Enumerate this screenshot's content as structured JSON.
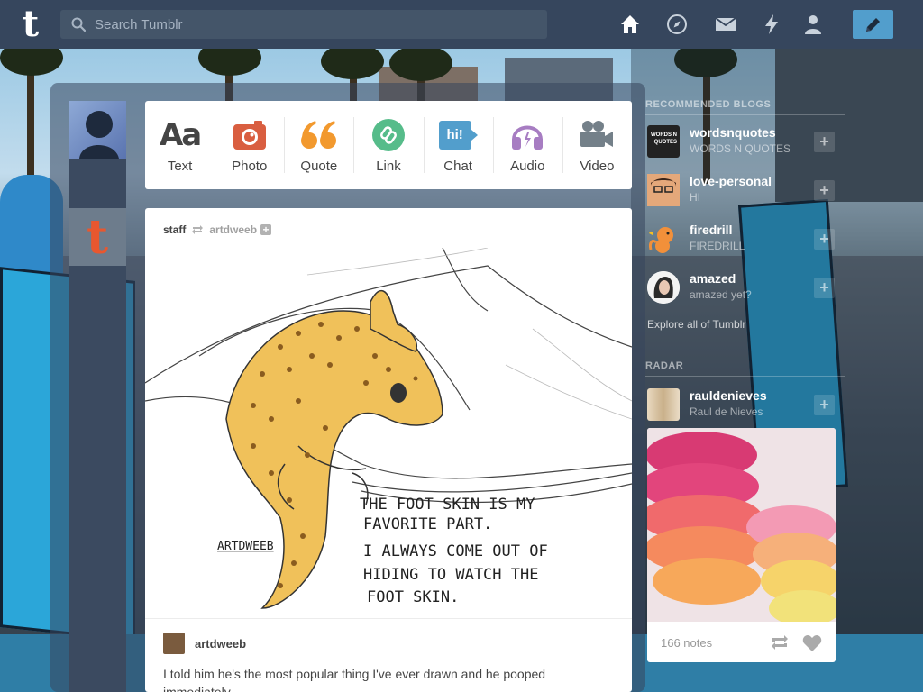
{
  "header": {
    "search_placeholder": "Search Tumblr",
    "logo_letter": "t"
  },
  "post_types": [
    {
      "label": "Text",
      "glyph": "Aa",
      "color": "#444444"
    },
    {
      "label": "Photo",
      "icon": "camera-icon",
      "color": "#d95e40"
    },
    {
      "label": "Quote",
      "icon": "quote-icon",
      "color": "#f2992e"
    },
    {
      "label": "Link",
      "icon": "link-icon",
      "color": "#56bc8a"
    },
    {
      "label": "Chat",
      "glyph": "hi!",
      "icon": "chat-icon",
      "color": "#529ecc"
    },
    {
      "label": "Audio",
      "icon": "headphones-icon",
      "color": "#a77dc2"
    },
    {
      "label": "Video",
      "icon": "video-camera-icon",
      "color": "#748089"
    }
  ],
  "post": {
    "blog": "staff",
    "reblogged_from": "artdweeb",
    "author": "artdweeb",
    "caption": "I told him he's the most popular thing I've ever drawn and he pooped immediately.",
    "image": {
      "text_lines": [
        "THE FOOT SKIN IS MY",
        "FAVORITE PART.",
        "I ALWAYS COME OUT OF",
        "HIDING TO WATCH THE",
        "FOOT SKIN."
      ],
      "signature": "ARTDWEEB"
    }
  },
  "sidebar": {
    "recommended_heading": "RECOMMENDED BLOGS",
    "blogs": [
      {
        "name": "wordsnquotes",
        "sub": "WORDS N QUOTES",
        "avatar_text": "WORDS N QUOTES"
      },
      {
        "name": "love-personal",
        "sub": "HI"
      },
      {
        "name": "firedrill",
        "sub": "FIREDRILL"
      },
      {
        "name": "amazed",
        "sub": "amazed yet?"
      }
    ],
    "explore_link": "Explore all of Tumblr",
    "radar_heading": "RADAR",
    "radar_blog": {
      "name": "rauldenieves",
      "sub": "Raul de Nieves"
    },
    "radar_notes": "166 notes"
  },
  "colors": {
    "header_bg": "#36465d",
    "compose_bg": "#529ecc"
  }
}
